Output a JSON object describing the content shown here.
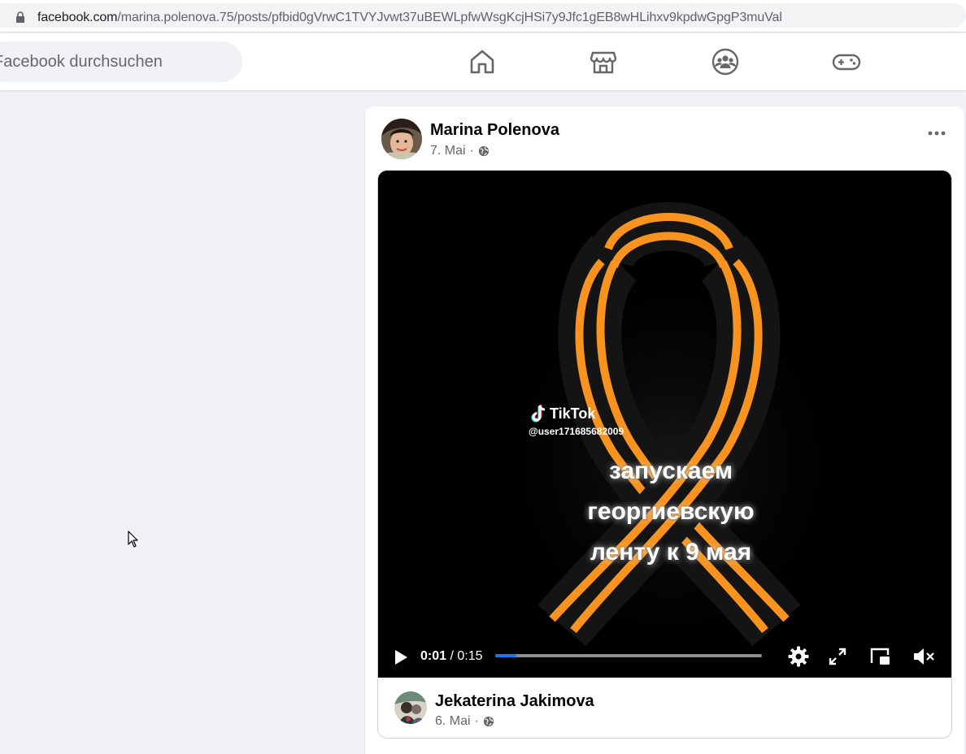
{
  "browser": {
    "url_host": "facebook.com",
    "url_path": "/marina.polenova.75/posts/pfbid0gVrwC1TVYJvwt37uBEWLpfwWsgKcjHSi7y9Jfc1gEB8wHLihxv9kpdwGpgP3muVal"
  },
  "header": {
    "search_placeholder": "Facebook durchsuchen",
    "nav_icons": [
      "home-icon",
      "marketplace-icon",
      "groups-icon",
      "gaming-icon"
    ]
  },
  "post": {
    "author": "Marina Polenova",
    "date": "7. Mai",
    "separator": "·",
    "privacy_icon": "globe-icon"
  },
  "video": {
    "tiktok_label": "TikTok",
    "tiktok_user": "@user171685682009",
    "caption_lines": [
      "запускаем",
      "георгиевскую",
      "ленту к 9 мая"
    ],
    "current_time": "0:01",
    "duration": "/ 0:15",
    "progress": 0.08,
    "controls": [
      "play-icon",
      "settings-icon",
      "fullscreen-icon",
      "picture-in-picture-icon",
      "mute-icon"
    ]
  },
  "shared_post": {
    "author": "Jekaterina Jakimova",
    "date": "6. Mai",
    "separator": "·"
  },
  "colors": {
    "accent": "#1877f2",
    "ribbon_orange": "#f7931e",
    "ribbon_black": "#1a1a1a",
    "page_bg": "#f0f2f5"
  }
}
